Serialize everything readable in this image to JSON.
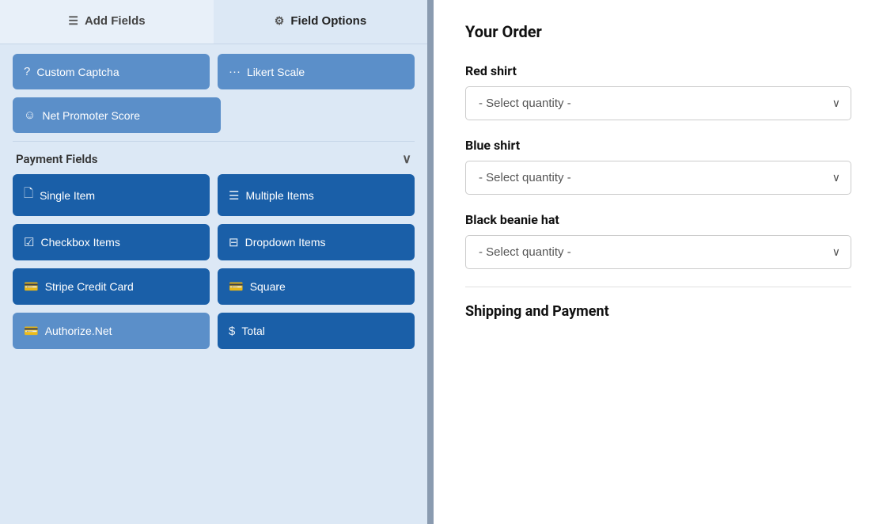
{
  "tabs": [
    {
      "id": "add-fields",
      "label": "Add Fields",
      "icon": "☰",
      "active": false
    },
    {
      "id": "field-options",
      "label": "Field Options",
      "icon": "⚙",
      "active": true
    }
  ],
  "left_panel": {
    "top_buttons": [
      {
        "id": "custom-captcha",
        "label": "Custom Captcha",
        "icon": "?",
        "style": "light"
      },
      {
        "id": "likert-scale",
        "label": "Likert Scale",
        "icon": "···",
        "style": "light"
      }
    ],
    "extra_buttons": [
      {
        "id": "net-promoter-score",
        "label": "Net Promoter Score",
        "icon": "☺",
        "style": "light"
      }
    ],
    "payment_section": {
      "label": "Payment Fields",
      "chevron": "∨",
      "buttons": [
        {
          "id": "single-item",
          "label": "Single Item",
          "icon": "📄",
          "style": "dark"
        },
        {
          "id": "multiple-items",
          "label": "Multiple Items",
          "icon": "☰",
          "style": "dark"
        },
        {
          "id": "checkbox-items",
          "label": "Checkbox Items",
          "icon": "☑",
          "style": "dark"
        },
        {
          "id": "dropdown-items",
          "label": "Dropdown Items",
          "icon": "⊟",
          "style": "dark"
        },
        {
          "id": "stripe-credit-card",
          "label": "Stripe Credit Card",
          "icon": "💳",
          "style": "dark"
        },
        {
          "id": "square",
          "label": "Square",
          "icon": "💳",
          "style": "dark"
        },
        {
          "id": "authorize-net",
          "label": "Authorize.Net",
          "icon": "💳",
          "style": "light"
        },
        {
          "id": "total",
          "label": "Total",
          "icon": "$",
          "style": "dark"
        }
      ]
    }
  },
  "right_panel": {
    "title": "Your Order",
    "items": [
      {
        "id": "red-shirt",
        "label": "Red shirt",
        "select_placeholder": "- Select quantity -"
      },
      {
        "id": "blue-shirt",
        "label": "Blue shirt",
        "select_placeholder": "- Select quantity -"
      },
      {
        "id": "black-beanie-hat",
        "label": "Black beanie hat",
        "select_placeholder": "- Select quantity -"
      }
    ],
    "shipping_label": "Shipping and Payment"
  }
}
